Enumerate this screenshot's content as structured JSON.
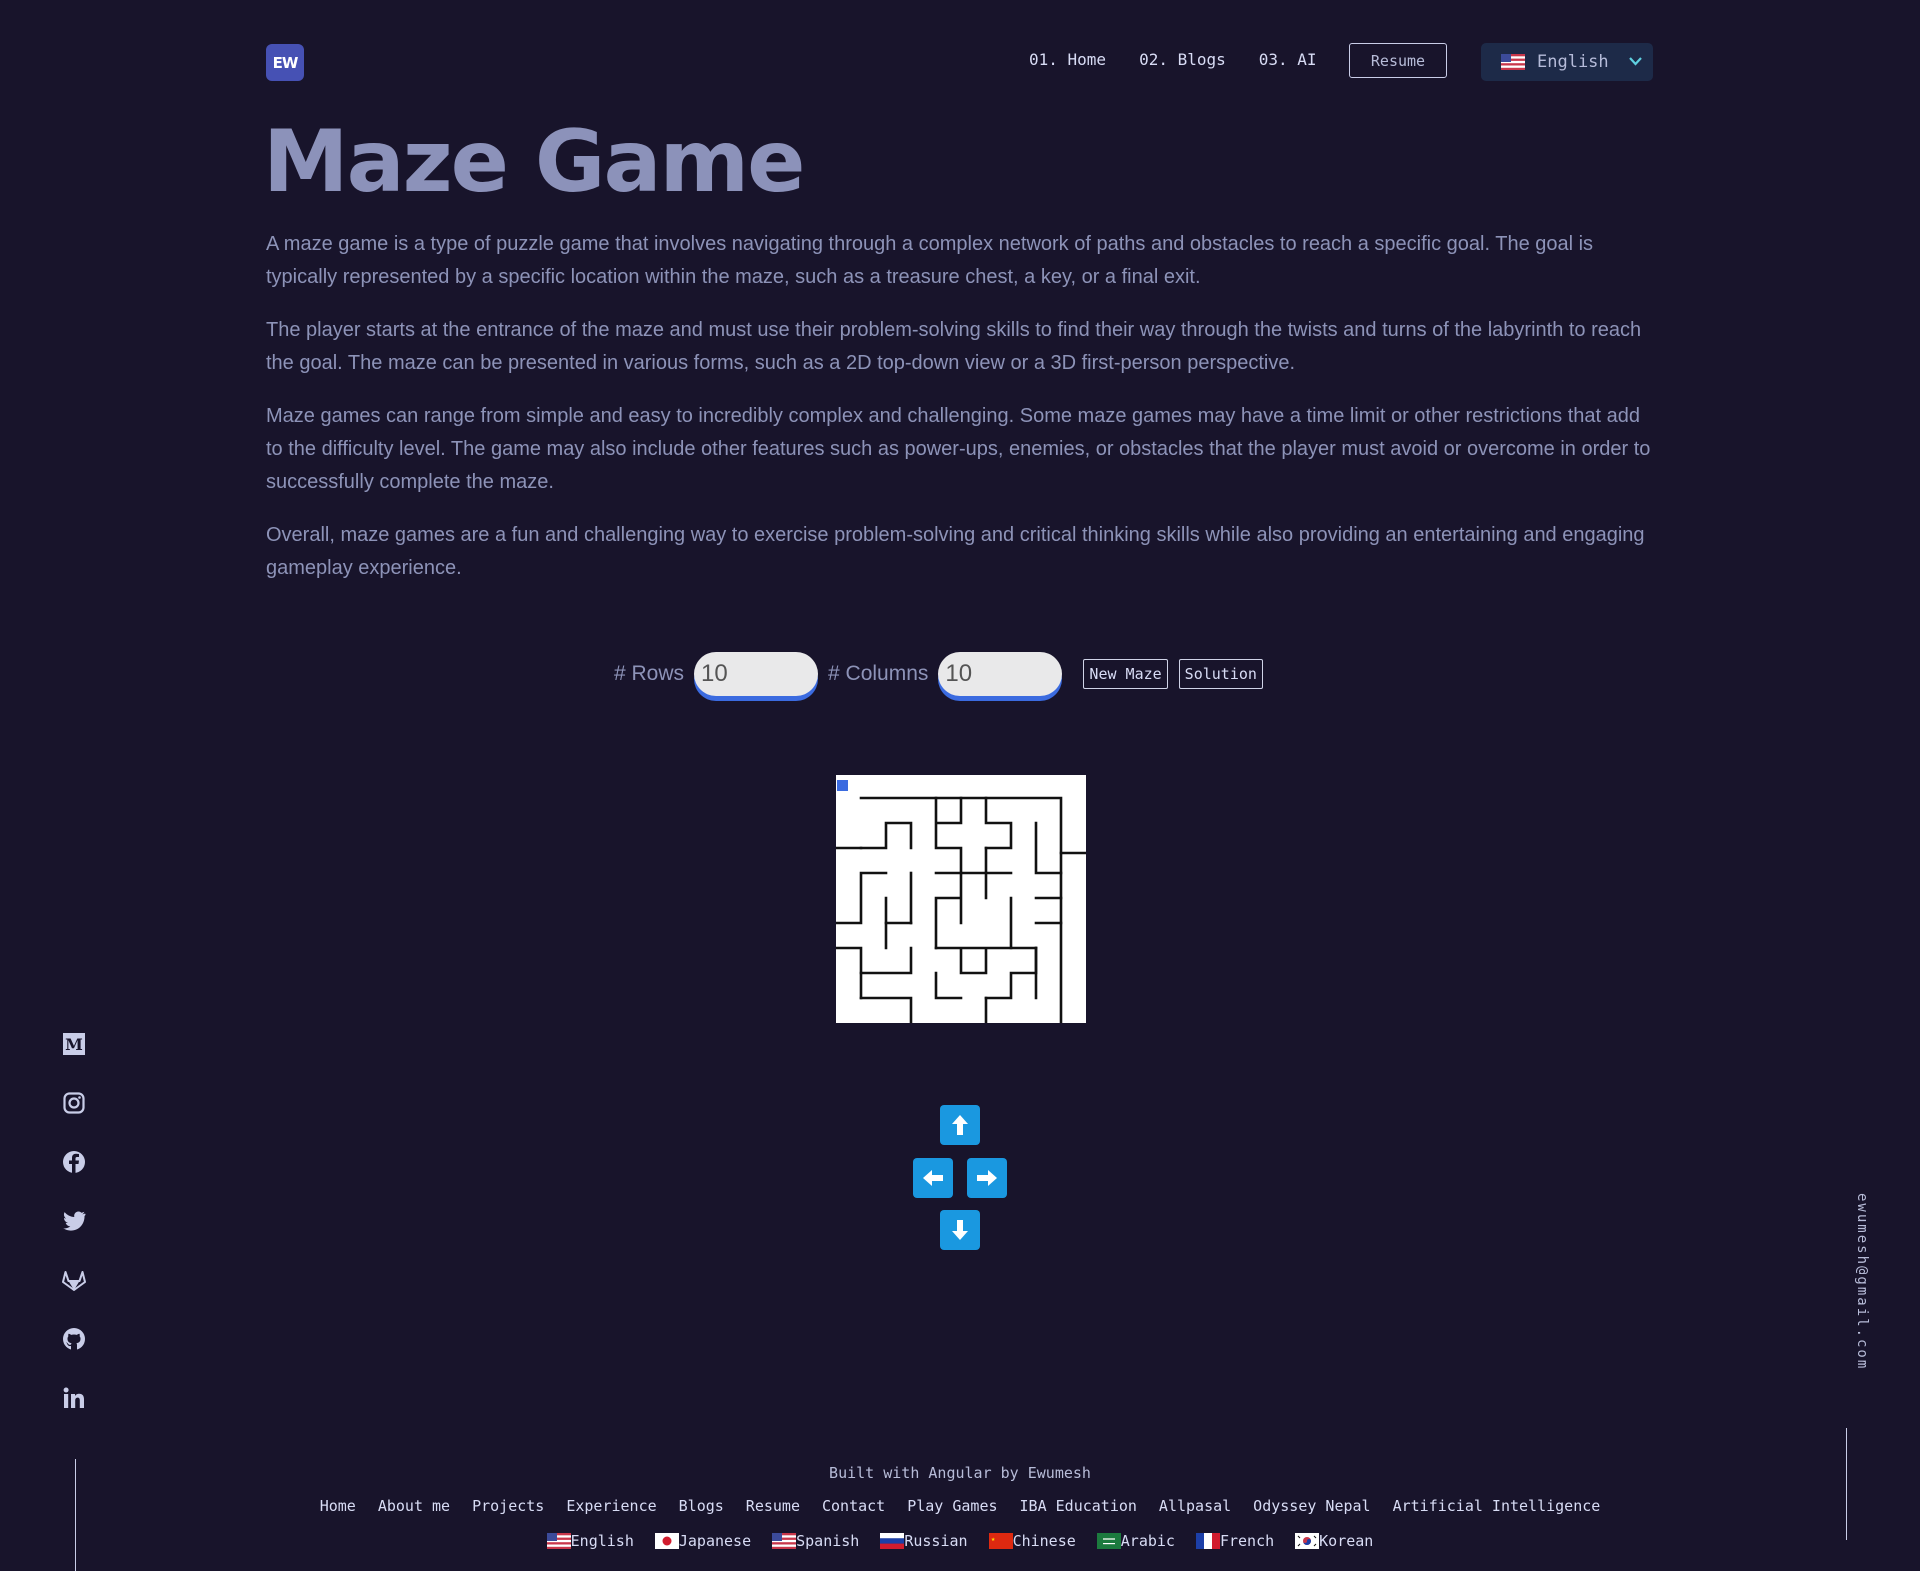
{
  "header": {
    "logo_text": "EW",
    "nav": [
      "01. Home",
      "02. Blogs",
      "03. AI"
    ],
    "resume_label": "Resume",
    "language": "English"
  },
  "page": {
    "title": "Maze Game",
    "paragraphs": [
      "A maze game is a type of puzzle game that involves navigating through a complex network of paths and obstacles to reach a specific goal. The goal is typically represented by a specific location within the maze, such as a treasure chest, a key, or a final exit.",
      "The player starts at the entrance of the maze and must use their problem-solving skills to find their way through the twists and turns of the labyrinth to reach the goal. The maze can be presented in various forms, such as a 2D top-down view or a 3D first-person perspective.",
      "Maze games can range from simple and easy to incredibly complex and challenging. Some maze games may have a time limit or other restrictions that add to the difficulty level. The game may also include other features such as power-ups, enemies, or obstacles that the player must avoid or overcome in order to successfully complete the maze.",
      "Overall, maze games are a fun and challenging way to exercise problem-solving and critical thinking skills while also providing an entertaining and engaging gameplay experience."
    ]
  },
  "controls": {
    "rows_label": "# Rows",
    "rows_value": "10",
    "columns_label": "# Columns",
    "columns_value": "10",
    "new_maze_label": "New Maze",
    "solution_label": "Solution"
  },
  "maze": {
    "rows": 10,
    "columns": 10,
    "player": {
      "row": 0,
      "col": 0,
      "color": "#3b6be0"
    }
  },
  "social": [
    "medium-icon",
    "instagram-icon",
    "facebook-icon",
    "twitter-icon",
    "gitlab-icon",
    "github-icon",
    "linkedin-icon"
  ],
  "email": "ewumesh@gmail.com",
  "footer": {
    "built_with": "Built with Angular by Ewumesh",
    "links": [
      "Home",
      "About me",
      "Projects",
      "Experience",
      "Blogs",
      "Resume",
      "Contact",
      "Play Games",
      "IBA Education",
      "Allpasal",
      "Odyssey Nepal",
      "Artificial Intelligence"
    ],
    "languages": [
      {
        "label": "English",
        "flag": "us-flag-icon"
      },
      {
        "label": "Japanese",
        "flag": "jp-flag-icon"
      },
      {
        "label": "Spanish",
        "flag": "us-flag-icon"
      },
      {
        "label": "Russian",
        "flag": "ru-flag-icon"
      },
      {
        "label": "Chinese",
        "flag": "cn-flag-icon"
      },
      {
        "label": "Arabic",
        "flag": "sa-flag-icon"
      },
      {
        "label": "French",
        "flag": "fr-flag-icon"
      },
      {
        "label": "Korean",
        "flag": "kr-flag-icon"
      }
    ]
  },
  "colors": {
    "background": "#18142b",
    "text": "#8d93b8",
    "accent": "#5fd0e0",
    "arrow_button": "#1a98e0"
  }
}
